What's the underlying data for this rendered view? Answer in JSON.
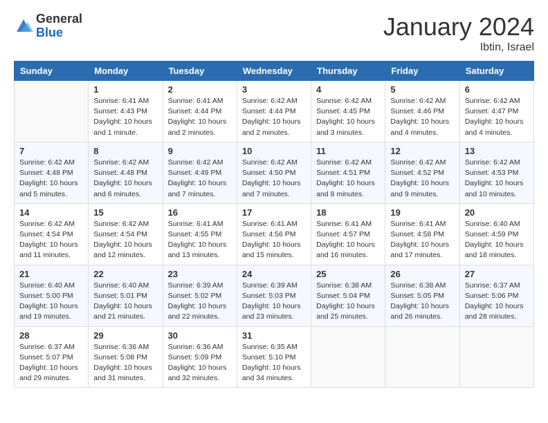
{
  "logo": {
    "general": "General",
    "blue": "Blue"
  },
  "header": {
    "month": "January 2024",
    "location": "Ibtin, Israel"
  },
  "weekdays": [
    "Sunday",
    "Monday",
    "Tuesday",
    "Wednesday",
    "Thursday",
    "Friday",
    "Saturday"
  ],
  "weeks": [
    [
      {
        "day": "",
        "sunrise": "",
        "sunset": "",
        "daylight": ""
      },
      {
        "day": "1",
        "sunrise": "Sunrise: 6:41 AM",
        "sunset": "Sunset: 4:43 PM",
        "daylight": "Daylight: 10 hours and 1 minute."
      },
      {
        "day": "2",
        "sunrise": "Sunrise: 6:41 AM",
        "sunset": "Sunset: 4:44 PM",
        "daylight": "Daylight: 10 hours and 2 minutes."
      },
      {
        "day": "3",
        "sunrise": "Sunrise: 6:42 AM",
        "sunset": "Sunset: 4:44 PM",
        "daylight": "Daylight: 10 hours and 2 minutes."
      },
      {
        "day": "4",
        "sunrise": "Sunrise: 6:42 AM",
        "sunset": "Sunset: 4:45 PM",
        "daylight": "Daylight: 10 hours and 3 minutes."
      },
      {
        "day": "5",
        "sunrise": "Sunrise: 6:42 AM",
        "sunset": "Sunset: 4:46 PM",
        "daylight": "Daylight: 10 hours and 4 minutes."
      },
      {
        "day": "6",
        "sunrise": "Sunrise: 6:42 AM",
        "sunset": "Sunset: 4:47 PM",
        "daylight": "Daylight: 10 hours and 4 minutes."
      }
    ],
    [
      {
        "day": "7",
        "sunrise": "Sunrise: 6:42 AM",
        "sunset": "Sunset: 4:48 PM",
        "daylight": "Daylight: 10 hours and 5 minutes."
      },
      {
        "day": "8",
        "sunrise": "Sunrise: 6:42 AM",
        "sunset": "Sunset: 4:48 PM",
        "daylight": "Daylight: 10 hours and 6 minutes."
      },
      {
        "day": "9",
        "sunrise": "Sunrise: 6:42 AM",
        "sunset": "Sunset: 4:49 PM",
        "daylight": "Daylight: 10 hours and 7 minutes."
      },
      {
        "day": "10",
        "sunrise": "Sunrise: 6:42 AM",
        "sunset": "Sunset: 4:50 PM",
        "daylight": "Daylight: 10 hours and 7 minutes."
      },
      {
        "day": "11",
        "sunrise": "Sunrise: 6:42 AM",
        "sunset": "Sunset: 4:51 PM",
        "daylight": "Daylight: 10 hours and 8 minutes."
      },
      {
        "day": "12",
        "sunrise": "Sunrise: 6:42 AM",
        "sunset": "Sunset: 4:52 PM",
        "daylight": "Daylight: 10 hours and 9 minutes."
      },
      {
        "day": "13",
        "sunrise": "Sunrise: 6:42 AM",
        "sunset": "Sunset: 4:53 PM",
        "daylight": "Daylight: 10 hours and 10 minutes."
      }
    ],
    [
      {
        "day": "14",
        "sunrise": "Sunrise: 6:42 AM",
        "sunset": "Sunset: 4:54 PM",
        "daylight": "Daylight: 10 hours and 11 minutes."
      },
      {
        "day": "15",
        "sunrise": "Sunrise: 6:42 AM",
        "sunset": "Sunset: 4:54 PM",
        "daylight": "Daylight: 10 hours and 12 minutes."
      },
      {
        "day": "16",
        "sunrise": "Sunrise: 6:41 AM",
        "sunset": "Sunset: 4:55 PM",
        "daylight": "Daylight: 10 hours and 13 minutes."
      },
      {
        "day": "17",
        "sunrise": "Sunrise: 6:41 AM",
        "sunset": "Sunset: 4:56 PM",
        "daylight": "Daylight: 10 hours and 15 minutes."
      },
      {
        "day": "18",
        "sunrise": "Sunrise: 6:41 AM",
        "sunset": "Sunset: 4:57 PM",
        "daylight": "Daylight: 10 hours and 16 minutes."
      },
      {
        "day": "19",
        "sunrise": "Sunrise: 6:41 AM",
        "sunset": "Sunset: 4:58 PM",
        "daylight": "Daylight: 10 hours and 17 minutes."
      },
      {
        "day": "20",
        "sunrise": "Sunrise: 6:40 AM",
        "sunset": "Sunset: 4:59 PM",
        "daylight": "Daylight: 10 hours and 18 minutes."
      }
    ],
    [
      {
        "day": "21",
        "sunrise": "Sunrise: 6:40 AM",
        "sunset": "Sunset: 5:00 PM",
        "daylight": "Daylight: 10 hours and 19 minutes."
      },
      {
        "day": "22",
        "sunrise": "Sunrise: 6:40 AM",
        "sunset": "Sunset: 5:01 PM",
        "daylight": "Daylight: 10 hours and 21 minutes."
      },
      {
        "day": "23",
        "sunrise": "Sunrise: 6:39 AM",
        "sunset": "Sunset: 5:02 PM",
        "daylight": "Daylight: 10 hours and 22 minutes."
      },
      {
        "day": "24",
        "sunrise": "Sunrise: 6:39 AM",
        "sunset": "Sunset: 5:03 PM",
        "daylight": "Daylight: 10 hours and 23 minutes."
      },
      {
        "day": "25",
        "sunrise": "Sunrise: 6:38 AM",
        "sunset": "Sunset: 5:04 PM",
        "daylight": "Daylight: 10 hours and 25 minutes."
      },
      {
        "day": "26",
        "sunrise": "Sunrise: 6:38 AM",
        "sunset": "Sunset: 5:05 PM",
        "daylight": "Daylight: 10 hours and 26 minutes."
      },
      {
        "day": "27",
        "sunrise": "Sunrise: 6:37 AM",
        "sunset": "Sunset: 5:06 PM",
        "daylight": "Daylight: 10 hours and 28 minutes."
      }
    ],
    [
      {
        "day": "28",
        "sunrise": "Sunrise: 6:37 AM",
        "sunset": "Sunset: 5:07 PM",
        "daylight": "Daylight: 10 hours and 29 minutes."
      },
      {
        "day": "29",
        "sunrise": "Sunrise: 6:36 AM",
        "sunset": "Sunset: 5:08 PM",
        "daylight": "Daylight: 10 hours and 31 minutes."
      },
      {
        "day": "30",
        "sunrise": "Sunrise: 6:36 AM",
        "sunset": "Sunset: 5:09 PM",
        "daylight": "Daylight: 10 hours and 32 minutes."
      },
      {
        "day": "31",
        "sunrise": "Sunrise: 6:35 AM",
        "sunset": "Sunset: 5:10 PM",
        "daylight": "Daylight: 10 hours and 34 minutes."
      },
      {
        "day": "",
        "sunrise": "",
        "sunset": "",
        "daylight": ""
      },
      {
        "day": "",
        "sunrise": "",
        "sunset": "",
        "daylight": ""
      },
      {
        "day": "",
        "sunrise": "",
        "sunset": "",
        "daylight": ""
      }
    ]
  ]
}
